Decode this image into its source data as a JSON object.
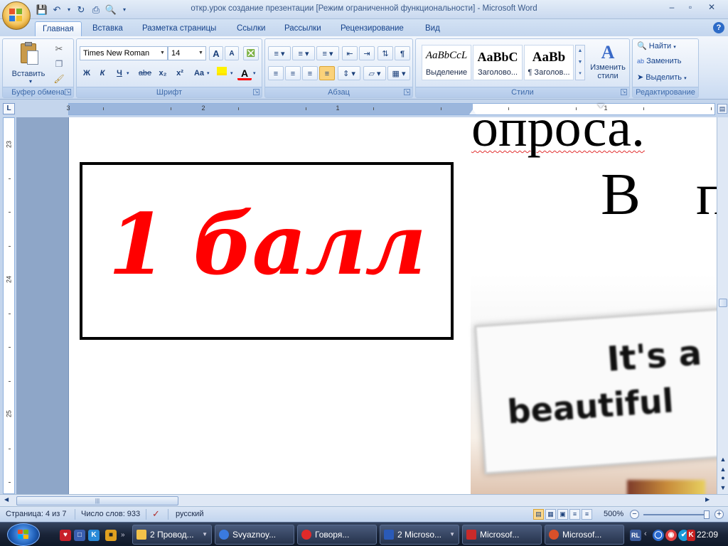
{
  "window": {
    "title": "откр.урок  создание презентации [Режим ограниченной функциональности] - Microsoft Word",
    "minimize": "–",
    "maximize": "▫",
    "close": "✕"
  },
  "tabs": [
    {
      "label": "Главная",
      "active": true
    },
    {
      "label": "Вставка"
    },
    {
      "label": "Разметка страницы"
    },
    {
      "label": "Ссылки"
    },
    {
      "label": "Рассылки"
    },
    {
      "label": "Рецензирование"
    },
    {
      "label": "Вид"
    }
  ],
  "help_label": "?",
  "ribbon": {
    "clipboard": {
      "label": "Буфер обмена",
      "paste": "Вставить"
    },
    "font": {
      "label": "Шрифт",
      "font_name": "Times New Roman",
      "font_size": "14",
      "bold": "Ж",
      "italic": "К",
      "underline": "Ч",
      "strike": "abe",
      "subscript": "x₂",
      "superscript": "x²",
      "change_case": "Aa",
      "grow": "A",
      "shrink": "A",
      "font_color": "A"
    },
    "paragraph": {
      "label": "Абзац"
    },
    "styles": {
      "label": "Стили",
      "items": [
        {
          "sample": "AaBbCcL",
          "name": "Выделение"
        },
        {
          "sample": "AaBbC",
          "name": "Заголово..."
        },
        {
          "sample": "AaBb",
          "name": "¶ Заголов..."
        }
      ],
      "change_styles": "Изменить стили"
    },
    "editing": {
      "label": "Редактирование",
      "find": "Найти",
      "replace": "Заменить",
      "select": "Выделить"
    }
  },
  "ruler": {
    "corner": "L",
    "h_numbers": [
      "3",
      "2",
      "1",
      "1"
    ],
    "v_numbers": [
      "23",
      "24",
      "25"
    ]
  },
  "document": {
    "score_text": "1 балл",
    "text_top": "опроса.",
    "text_v": "В",
    "text_p": "п",
    "image_line1": "It's a",
    "image_line2": "beautiful"
  },
  "status": {
    "page": "Страница: 4 из 7",
    "words": "Число слов: 933",
    "language": "русский",
    "zoom": "500%"
  },
  "taskbar": {
    "tasks": [
      {
        "label": "2 Провод...",
        "color": "#f2c24a"
      },
      {
        "label": "Svyaznoy...",
        "color": "#3a7adf"
      },
      {
        "label": "Говоря...",
        "color": "#e02a2a"
      },
      {
        "label": "2 Microso...",
        "color": "#2a5ab8"
      },
      {
        "label": "Microsof...",
        "color": "#c82a2a"
      },
      {
        "label": "Microsof...",
        "color": "#d9502a"
      }
    ],
    "lang": "RL",
    "clock": "22:09"
  },
  "colors": {
    "score_red": "#ff0000",
    "accent_blue": "#15428b"
  }
}
